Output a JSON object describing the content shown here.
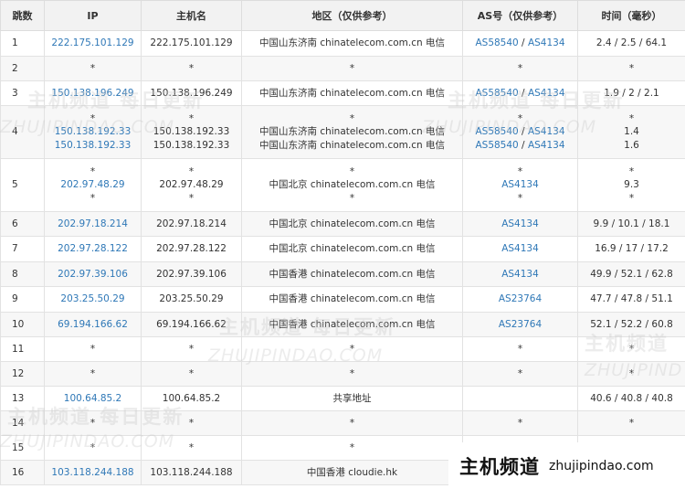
{
  "headers": {
    "hop": "跳数",
    "ip": "IP",
    "host": "主机名",
    "region": "地区（仅供参考）",
    "as": "AS号（仅供参考）",
    "time": "时间（毫秒）"
  },
  "rows": [
    {
      "hop": "1",
      "ip": [
        "222.175.101.129"
      ],
      "host": [
        "222.175.101.129"
      ],
      "region": [
        "中国山东济南 chinatelecom.com.cn 电信"
      ],
      "as": [
        [
          "AS58540",
          "AS4134"
        ]
      ],
      "time": [
        "2.4 / 2.5 / 64.1"
      ]
    },
    {
      "hop": "2",
      "ip": [
        "*"
      ],
      "host": [
        "*"
      ],
      "region": [
        "*"
      ],
      "as": [
        [
          "*"
        ]
      ],
      "time": [
        "*"
      ]
    },
    {
      "hop": "3",
      "ip": [
        "150.138.196.249"
      ],
      "host": [
        "150.138.196.249"
      ],
      "region": [
        "中国山东济南 chinatelecom.com.cn 电信"
      ],
      "as": [
        [
          "AS58540",
          "AS4134"
        ]
      ],
      "time": [
        "1.9 / 2 / 2.1"
      ]
    },
    {
      "hop": "4",
      "ip": [
        "*",
        "150.138.192.33",
        "150.138.192.33"
      ],
      "host": [
        "*",
        "150.138.192.33",
        "150.138.192.33"
      ],
      "region": [
        "*",
        "中国山东济南 chinatelecom.com.cn 电信",
        "中国山东济南 chinatelecom.com.cn 电信"
      ],
      "as": [
        [
          "*"
        ],
        [
          "AS58540",
          "AS4134"
        ],
        [
          "AS58540",
          "AS4134"
        ]
      ],
      "time": [
        "*",
        "1.4",
        "1.6"
      ]
    },
    {
      "hop": "5",
      "ip": [
        "*",
        "202.97.48.29",
        "*"
      ],
      "host": [
        "*",
        "202.97.48.29",
        "*"
      ],
      "region": [
        "*",
        "中国北京 chinatelecom.com.cn 电信",
        "*"
      ],
      "as": [
        [
          "*"
        ],
        [
          "AS4134"
        ],
        [
          "*"
        ]
      ],
      "time": [
        "*",
        "9.3",
        "*"
      ]
    },
    {
      "hop": "6",
      "ip": [
        "202.97.18.214"
      ],
      "host": [
        "202.97.18.214"
      ],
      "region": [
        "中国北京 chinatelecom.com.cn 电信"
      ],
      "as": [
        [
          "AS4134"
        ]
      ],
      "time": [
        "9.9 / 10.1 / 18.1"
      ]
    },
    {
      "hop": "7",
      "ip": [
        "202.97.28.122"
      ],
      "host": [
        "202.97.28.122"
      ],
      "region": [
        "中国北京 chinatelecom.com.cn 电信"
      ],
      "as": [
        [
          "AS4134"
        ]
      ],
      "time": [
        "16.9 / 17 / 17.2"
      ]
    },
    {
      "hop": "8",
      "ip": [
        "202.97.39.106"
      ],
      "host": [
        "202.97.39.106"
      ],
      "region": [
        "中国香港 chinatelecom.com.cn 电信"
      ],
      "as": [
        [
          "AS4134"
        ]
      ],
      "time": [
        "49.9 / 52.1 / 62.8"
      ]
    },
    {
      "hop": "9",
      "ip": [
        "203.25.50.29"
      ],
      "host": [
        "203.25.50.29"
      ],
      "region": [
        "中国香港 chinatelecom.com.cn 电信"
      ],
      "as": [
        [
          "AS23764"
        ]
      ],
      "time": [
        "47.7 / 47.8 / 51.1"
      ]
    },
    {
      "hop": "10",
      "ip": [
        "69.194.166.62"
      ],
      "host": [
        "69.194.166.62"
      ],
      "region": [
        "中国香港 chinatelecom.com.cn 电信"
      ],
      "as": [
        [
          "AS23764"
        ]
      ],
      "time": [
        "52.1 / 52.2 / 60.8"
      ]
    },
    {
      "hop": "11",
      "ip": [
        "*"
      ],
      "host": [
        "*"
      ],
      "region": [
        "*"
      ],
      "as": [
        [
          "*"
        ]
      ],
      "time": [
        "*"
      ]
    },
    {
      "hop": "12",
      "ip": [
        "*"
      ],
      "host": [
        "*"
      ],
      "region": [
        "*"
      ],
      "as": [
        [
          "*"
        ]
      ],
      "time": [
        "*"
      ]
    },
    {
      "hop": "13",
      "ip": [
        "100.64.85.2"
      ],
      "host": [
        "100.64.85.2"
      ],
      "region": [
        "共享地址"
      ],
      "as": [
        []
      ],
      "time": [
        "40.6 / 40.8 / 40.8"
      ]
    },
    {
      "hop": "14",
      "ip": [
        "*"
      ],
      "host": [
        "*"
      ],
      "region": [
        "*"
      ],
      "as": [
        [
          "*"
        ]
      ],
      "time": [
        "*"
      ]
    },
    {
      "hop": "15",
      "ip": [
        "*"
      ],
      "host": [
        "*"
      ],
      "region": [
        "*"
      ],
      "as": [
        [
          "*"
        ]
      ],
      "time": [
        "*"
      ]
    },
    {
      "hop": "16",
      "ip": [
        "103.118.244.188"
      ],
      "host": [
        "103.118.244.188"
      ],
      "region": [
        "中国香港 cloudie.hk"
      ],
      "as": [
        []
      ],
      "time": [
        ""
      ]
    }
  ],
  "watermark": {
    "cn": "主机频道 每日更新",
    "cn_short": "主机频道",
    "en": "ZHUJIPINDAO.COM",
    "en_short": "ZHUJIPIND"
  },
  "brand": {
    "cn": "主机频道",
    "en": "zhujipindao.com"
  }
}
